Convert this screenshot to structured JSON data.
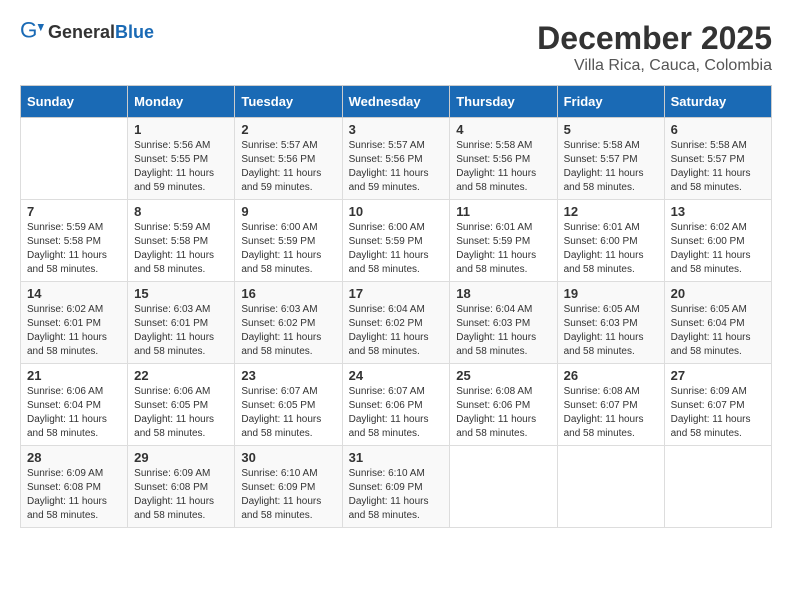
{
  "header": {
    "logo_general": "General",
    "logo_blue": "Blue",
    "title": "December 2025",
    "subtitle": "Villa Rica, Cauca, Colombia"
  },
  "calendar": {
    "days_of_week": [
      "Sunday",
      "Monday",
      "Tuesday",
      "Wednesday",
      "Thursday",
      "Friday",
      "Saturday"
    ],
    "weeks": [
      [
        {
          "day": "",
          "info": ""
        },
        {
          "day": "1",
          "info": "Sunrise: 5:56 AM\nSunset: 5:55 PM\nDaylight: 11 hours and 59 minutes."
        },
        {
          "day": "2",
          "info": "Sunrise: 5:57 AM\nSunset: 5:56 PM\nDaylight: 11 hours and 59 minutes."
        },
        {
          "day": "3",
          "info": "Sunrise: 5:57 AM\nSunset: 5:56 PM\nDaylight: 11 hours and 59 minutes."
        },
        {
          "day": "4",
          "info": "Sunrise: 5:58 AM\nSunset: 5:56 PM\nDaylight: 11 hours and 58 minutes."
        },
        {
          "day": "5",
          "info": "Sunrise: 5:58 AM\nSunset: 5:57 PM\nDaylight: 11 hours and 58 minutes."
        },
        {
          "day": "6",
          "info": "Sunrise: 5:58 AM\nSunset: 5:57 PM\nDaylight: 11 hours and 58 minutes."
        }
      ],
      [
        {
          "day": "7",
          "info": "Sunrise: 5:59 AM\nSunset: 5:58 PM\nDaylight: 11 hours and 58 minutes."
        },
        {
          "day": "8",
          "info": "Sunrise: 5:59 AM\nSunset: 5:58 PM\nDaylight: 11 hours and 58 minutes."
        },
        {
          "day": "9",
          "info": "Sunrise: 6:00 AM\nSunset: 5:59 PM\nDaylight: 11 hours and 58 minutes."
        },
        {
          "day": "10",
          "info": "Sunrise: 6:00 AM\nSunset: 5:59 PM\nDaylight: 11 hours and 58 minutes."
        },
        {
          "day": "11",
          "info": "Sunrise: 6:01 AM\nSunset: 5:59 PM\nDaylight: 11 hours and 58 minutes."
        },
        {
          "day": "12",
          "info": "Sunrise: 6:01 AM\nSunset: 6:00 PM\nDaylight: 11 hours and 58 minutes."
        },
        {
          "day": "13",
          "info": "Sunrise: 6:02 AM\nSunset: 6:00 PM\nDaylight: 11 hours and 58 minutes."
        }
      ],
      [
        {
          "day": "14",
          "info": "Sunrise: 6:02 AM\nSunset: 6:01 PM\nDaylight: 11 hours and 58 minutes."
        },
        {
          "day": "15",
          "info": "Sunrise: 6:03 AM\nSunset: 6:01 PM\nDaylight: 11 hours and 58 minutes."
        },
        {
          "day": "16",
          "info": "Sunrise: 6:03 AM\nSunset: 6:02 PM\nDaylight: 11 hours and 58 minutes."
        },
        {
          "day": "17",
          "info": "Sunrise: 6:04 AM\nSunset: 6:02 PM\nDaylight: 11 hours and 58 minutes."
        },
        {
          "day": "18",
          "info": "Sunrise: 6:04 AM\nSunset: 6:03 PM\nDaylight: 11 hours and 58 minutes."
        },
        {
          "day": "19",
          "info": "Sunrise: 6:05 AM\nSunset: 6:03 PM\nDaylight: 11 hours and 58 minutes."
        },
        {
          "day": "20",
          "info": "Sunrise: 6:05 AM\nSunset: 6:04 PM\nDaylight: 11 hours and 58 minutes."
        }
      ],
      [
        {
          "day": "21",
          "info": "Sunrise: 6:06 AM\nSunset: 6:04 PM\nDaylight: 11 hours and 58 minutes."
        },
        {
          "day": "22",
          "info": "Sunrise: 6:06 AM\nSunset: 6:05 PM\nDaylight: 11 hours and 58 minutes."
        },
        {
          "day": "23",
          "info": "Sunrise: 6:07 AM\nSunset: 6:05 PM\nDaylight: 11 hours and 58 minutes."
        },
        {
          "day": "24",
          "info": "Sunrise: 6:07 AM\nSunset: 6:06 PM\nDaylight: 11 hours and 58 minutes."
        },
        {
          "day": "25",
          "info": "Sunrise: 6:08 AM\nSunset: 6:06 PM\nDaylight: 11 hours and 58 minutes."
        },
        {
          "day": "26",
          "info": "Sunrise: 6:08 AM\nSunset: 6:07 PM\nDaylight: 11 hours and 58 minutes."
        },
        {
          "day": "27",
          "info": "Sunrise: 6:09 AM\nSunset: 6:07 PM\nDaylight: 11 hours and 58 minutes."
        }
      ],
      [
        {
          "day": "28",
          "info": "Sunrise: 6:09 AM\nSunset: 6:08 PM\nDaylight: 11 hours and 58 minutes."
        },
        {
          "day": "29",
          "info": "Sunrise: 6:09 AM\nSunset: 6:08 PM\nDaylight: 11 hours and 58 minutes."
        },
        {
          "day": "30",
          "info": "Sunrise: 6:10 AM\nSunset: 6:09 PM\nDaylight: 11 hours and 58 minutes."
        },
        {
          "day": "31",
          "info": "Sunrise: 6:10 AM\nSunset: 6:09 PM\nDaylight: 11 hours and 58 minutes."
        },
        {
          "day": "",
          "info": ""
        },
        {
          "day": "",
          "info": ""
        },
        {
          "day": "",
          "info": ""
        }
      ]
    ]
  }
}
